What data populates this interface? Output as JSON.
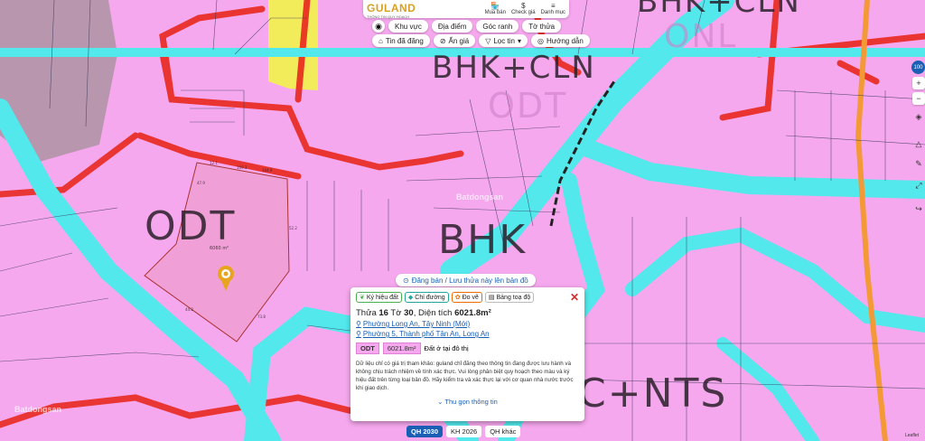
{
  "header": {
    "logo": "GULAND",
    "logo_sub": "THÔNG TIN QUY HOẠCH",
    "actions": [
      {
        "label": "Mua bán",
        "icon": "store-icon"
      },
      {
        "label": "Check giá",
        "icon": "dollar-icon"
      },
      {
        "label": "Danh mục",
        "icon": "menu-icon"
      }
    ]
  },
  "filters_row1": [
    "Khu vực",
    "Địa điểm",
    "Góc ranh",
    "Tờ thửa"
  ],
  "filters_row2": [
    "Tin đã đăng",
    "Ẩn giá",
    "Lọc tin",
    "Hướng dẫn"
  ],
  "zones": {
    "odt_main": "ODT",
    "bhk": "BHK",
    "bhk_cln": "BHK+CLN",
    "odt_top": "ODT",
    "onl": "ONL",
    "c_nts": "C+NTS",
    "bhk_top": "BHK+CLN"
  },
  "parcel": {
    "area_label": "6060 m²",
    "edge_labels": [
      "47.9",
      "12.1",
      "109.3",
      "104.9",
      "52.2",
      "73.8",
      "44.2"
    ]
  },
  "zoom_level": "100",
  "post_button": "Đăng bán / Lưu thửa này lên bản đồ",
  "popup": {
    "tabs": [
      "Ký hiệu đất",
      "Chỉ đường",
      "Đo vẽ",
      "Bảng toạ độ"
    ],
    "title_prefix": "Thửa",
    "parcel_no": "16",
    "sheet_prefix": "Tờ",
    "sheet_no": "30",
    "area_prefix": "Diện tích",
    "area": "6021.8m²",
    "address_new": "Phường Long An, Tây Ninh (Mới)",
    "address_old": "Phường 5, Thành phố Tân An, Long An",
    "land_code": "ODT",
    "land_area": "6021.8m²",
    "land_desc": "Đất ở tại đô thị",
    "disclaimer": "Dữ liệu chỉ có giá trị tham khảo: guland chỉ đăng theo thông tin đang được lưu hành và không chịu trách nhiệm về tính xác thực. Vui lòng phân biệt quy hoạch theo màu và ký hiệu đất trên từng loại bản đồ. Hãy kiểm tra và xác thực lại với cơ quan nhà nước trước khi giao dịch.",
    "collapse": "Thu gọn thông tin"
  },
  "bottom_tabs": [
    "QH 2030",
    "KH 2026",
    "QH khác"
  ],
  "attribution": "Leaflet",
  "watermark": "Batdongsan",
  "colors": {
    "residential": "#f6a8ee",
    "water": "#52e8ec",
    "road": "#e8281e",
    "selected": "#f0a0d6",
    "brand": "#d8a024",
    "accent": "#1a5fb4"
  }
}
